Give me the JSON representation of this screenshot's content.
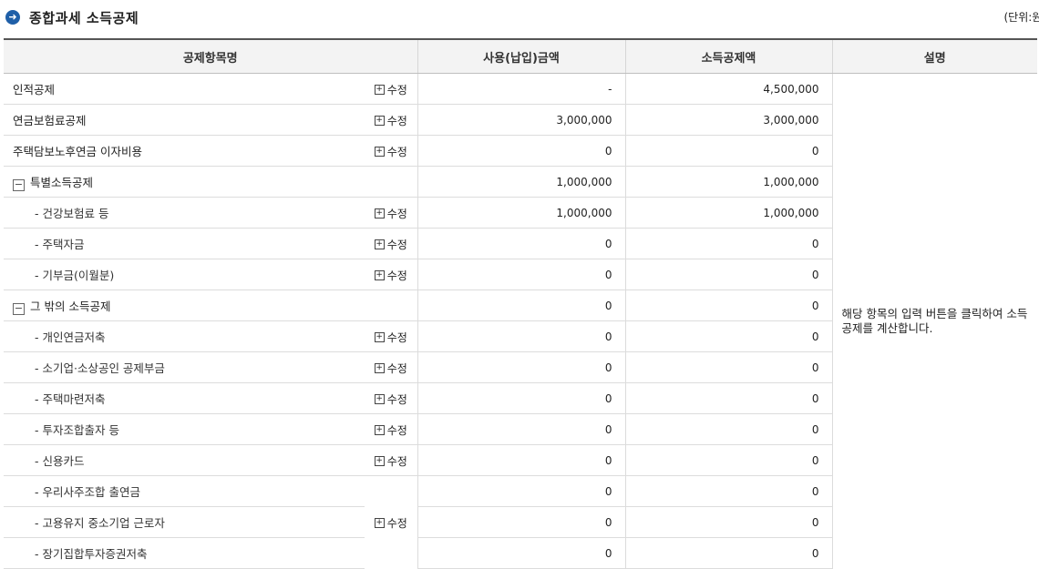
{
  "header": {
    "title": "종합과세 소득공제",
    "unit": "(단위:원)"
  },
  "table": {
    "columns": [
      "공제항목명",
      "사용(납입)금액",
      "소득공제액",
      "설명"
    ],
    "edit_label": "수정",
    "description": "해당 항목의 입력 버튼을 클릭하여 소득공제를 계산합니다.",
    "rows": [
      {
        "name": "인적공제",
        "level": 0,
        "edit": true,
        "amount": "-",
        "deduction": "4,500,000"
      },
      {
        "name": "연금보험료공제",
        "level": 0,
        "edit": true,
        "amount": "3,000,000",
        "deduction": "3,000,000"
      },
      {
        "name": "주택담보노후연금 이자비용",
        "level": 0,
        "edit": true,
        "amount": "0",
        "deduction": "0"
      },
      {
        "name": "특별소득공제",
        "level": 0,
        "collapsible": true,
        "edit": false,
        "amount": "1,000,000",
        "deduction": "1,000,000"
      },
      {
        "name": "- 건강보험료 등",
        "level": 1,
        "edit": true,
        "amount": "1,000,000",
        "deduction": "1,000,000"
      },
      {
        "name": "- 주택자금",
        "level": 1,
        "edit": true,
        "amount": "0",
        "deduction": "0"
      },
      {
        "name": "- 기부금(이월분)",
        "level": 1,
        "edit": true,
        "amount": "0",
        "deduction": "0"
      },
      {
        "name": "그 밖의 소득공제",
        "level": 0,
        "collapsible": true,
        "edit": false,
        "amount": "0",
        "deduction": "0"
      },
      {
        "name": "- 개인연금저축",
        "level": 1,
        "edit": true,
        "amount": "0",
        "deduction": "0"
      },
      {
        "name": "- 소기업·소상공인 공제부금",
        "level": 1,
        "edit": true,
        "amount": "0",
        "deduction": "0"
      },
      {
        "name": "- 주택마련저축",
        "level": 1,
        "edit": true,
        "amount": "0",
        "deduction": "0"
      },
      {
        "name": "- 투자조합출자 등",
        "level": 1,
        "edit": true,
        "amount": "0",
        "deduction": "0"
      },
      {
        "name": "- 신용카드",
        "level": 1,
        "edit": true,
        "amount": "0",
        "deduction": "0"
      },
      {
        "name": "- 우리사주조합 출연금",
        "level": 1,
        "edit": "shared",
        "amount": "0",
        "deduction": "0"
      },
      {
        "name": "- 고용유지 중소기업 근로자",
        "level": 1,
        "edit": "shared",
        "amount": "0",
        "deduction": "0"
      },
      {
        "name": "- 장기집합투자증권저축",
        "level": 1,
        "edit": "shared",
        "amount": "0",
        "deduction": "0"
      }
    ]
  }
}
